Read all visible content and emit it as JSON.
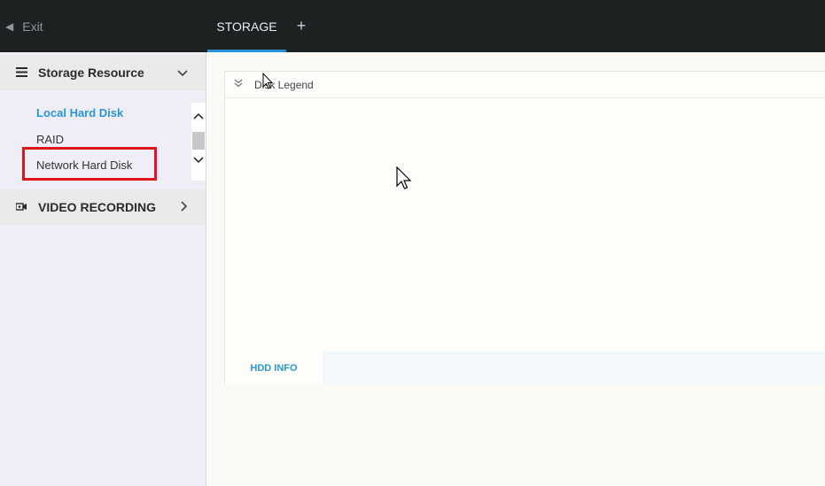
{
  "topbar": {
    "exit_label": "Exit",
    "exit_icon": "arrow-left-icon",
    "tab_label": "STORAGE",
    "add_tab_glyph": "+"
  },
  "sidebar": {
    "storage_resource": {
      "label": "Storage Resource",
      "icon": "menu-icon",
      "expanded": true,
      "items": [
        {
          "label": "Local Hard Disk",
          "active": true
        },
        {
          "label": "RAID"
        },
        {
          "label": "Network Hard Disk",
          "highlighted": true
        }
      ]
    },
    "video_recording": {
      "label": "VIDEO RECORDING",
      "icon": "video-settings-icon",
      "expanded": false
    }
  },
  "main": {
    "legend_label": "Disk Legend",
    "hdd_info_tab": "HDD INFO"
  },
  "colors": {
    "accent": "#2b95d6",
    "topbar": "#1d2122",
    "highlight_box": "#e0141c"
  }
}
